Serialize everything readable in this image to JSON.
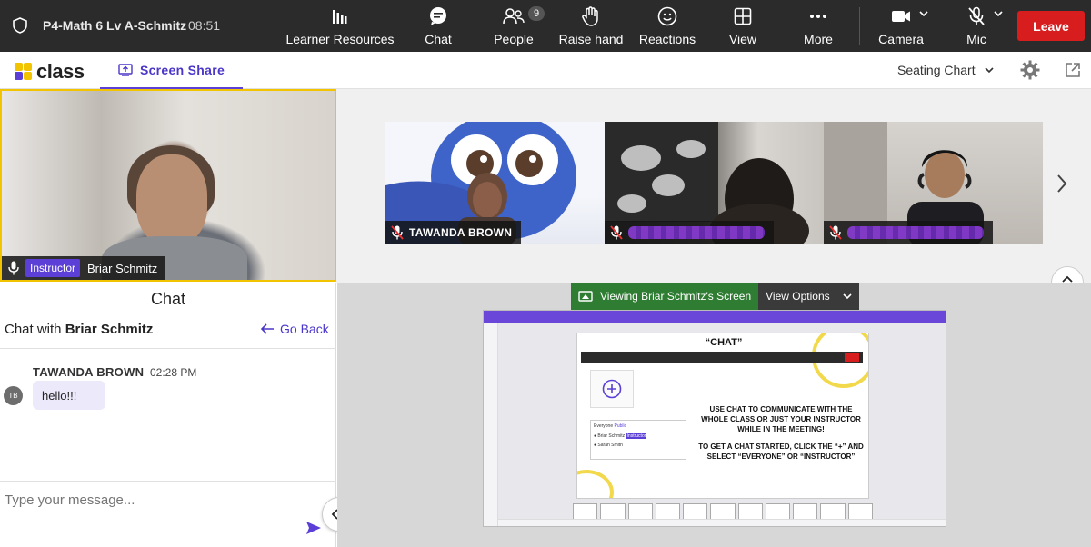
{
  "topbar": {
    "room_title": "P4-Math 6 Lv A-Schmitz",
    "time": "08:51",
    "buttons": {
      "learner_resources": "Learner Resources",
      "chat": "Chat",
      "people": "People",
      "people_count": "9",
      "raise_hand": "Raise hand",
      "reactions": "Reactions",
      "view": "View",
      "more": "More",
      "camera": "Camera",
      "mic": "Mic",
      "leave": "Leave"
    }
  },
  "subbar": {
    "logo_text": "class",
    "screen_share_tab": "Screen Share",
    "seating_chart": "Seating Chart"
  },
  "instructor": {
    "role": "Instructor",
    "name": "Briar Schmitz"
  },
  "gallery": {
    "tiles": [
      {
        "name": "TAWANDA BROWN",
        "muted": true
      },
      {
        "name": "",
        "muted": true
      },
      {
        "name": "",
        "muted": true
      }
    ]
  },
  "chat": {
    "title": "Chat",
    "with_prefix": "Chat with",
    "with_name": "Briar Schmitz",
    "go_back": "Go Back",
    "messages": [
      {
        "initials": "TB",
        "sender": "TAWANDA BROWN",
        "time": "02:28 PM",
        "text": "hello!!!"
      }
    ],
    "input_placeholder": "Type your message..."
  },
  "share": {
    "viewing_label": "Viewing Briar Schmitz's Screen",
    "view_options": "View Options",
    "slide": {
      "title": "“CHAT”",
      "body_1": "USE CHAT TO COMMUNICATE WITH THE WHOLE CLASS OR JUST YOUR INSTRUCTOR WHILE IN THE MEETING!",
      "body_2": "TO GET A CHAT STARTED, CLICK THE “+” AND SELECT “EVERYONE” OR “INSTRUCTOR”",
      "list_header": "Everyone",
      "list_tag": "Public",
      "list_item_1": "Briar Schmitz",
      "list_item_1_tag": "Instructor",
      "list_item_2": "Sarah Smith"
    }
  },
  "colors": {
    "accent": "#5b3fd6",
    "leave": "#d71d1d",
    "viewing_green": "#2e7d32",
    "instructor_border": "#f2c400"
  }
}
